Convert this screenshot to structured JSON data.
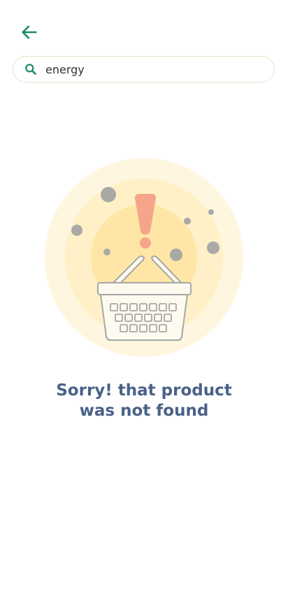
{
  "header": {
    "back_icon": "arrow-left-icon",
    "accent_color": "#1b8a5a"
  },
  "search": {
    "icon": "search-icon",
    "value": "energy",
    "placeholder": ""
  },
  "empty_state": {
    "illustration_icon": "basket-alert-icon",
    "message_line1": "Sorry! that product",
    "message_line2": "was not found",
    "message_color": "#4a6288"
  }
}
